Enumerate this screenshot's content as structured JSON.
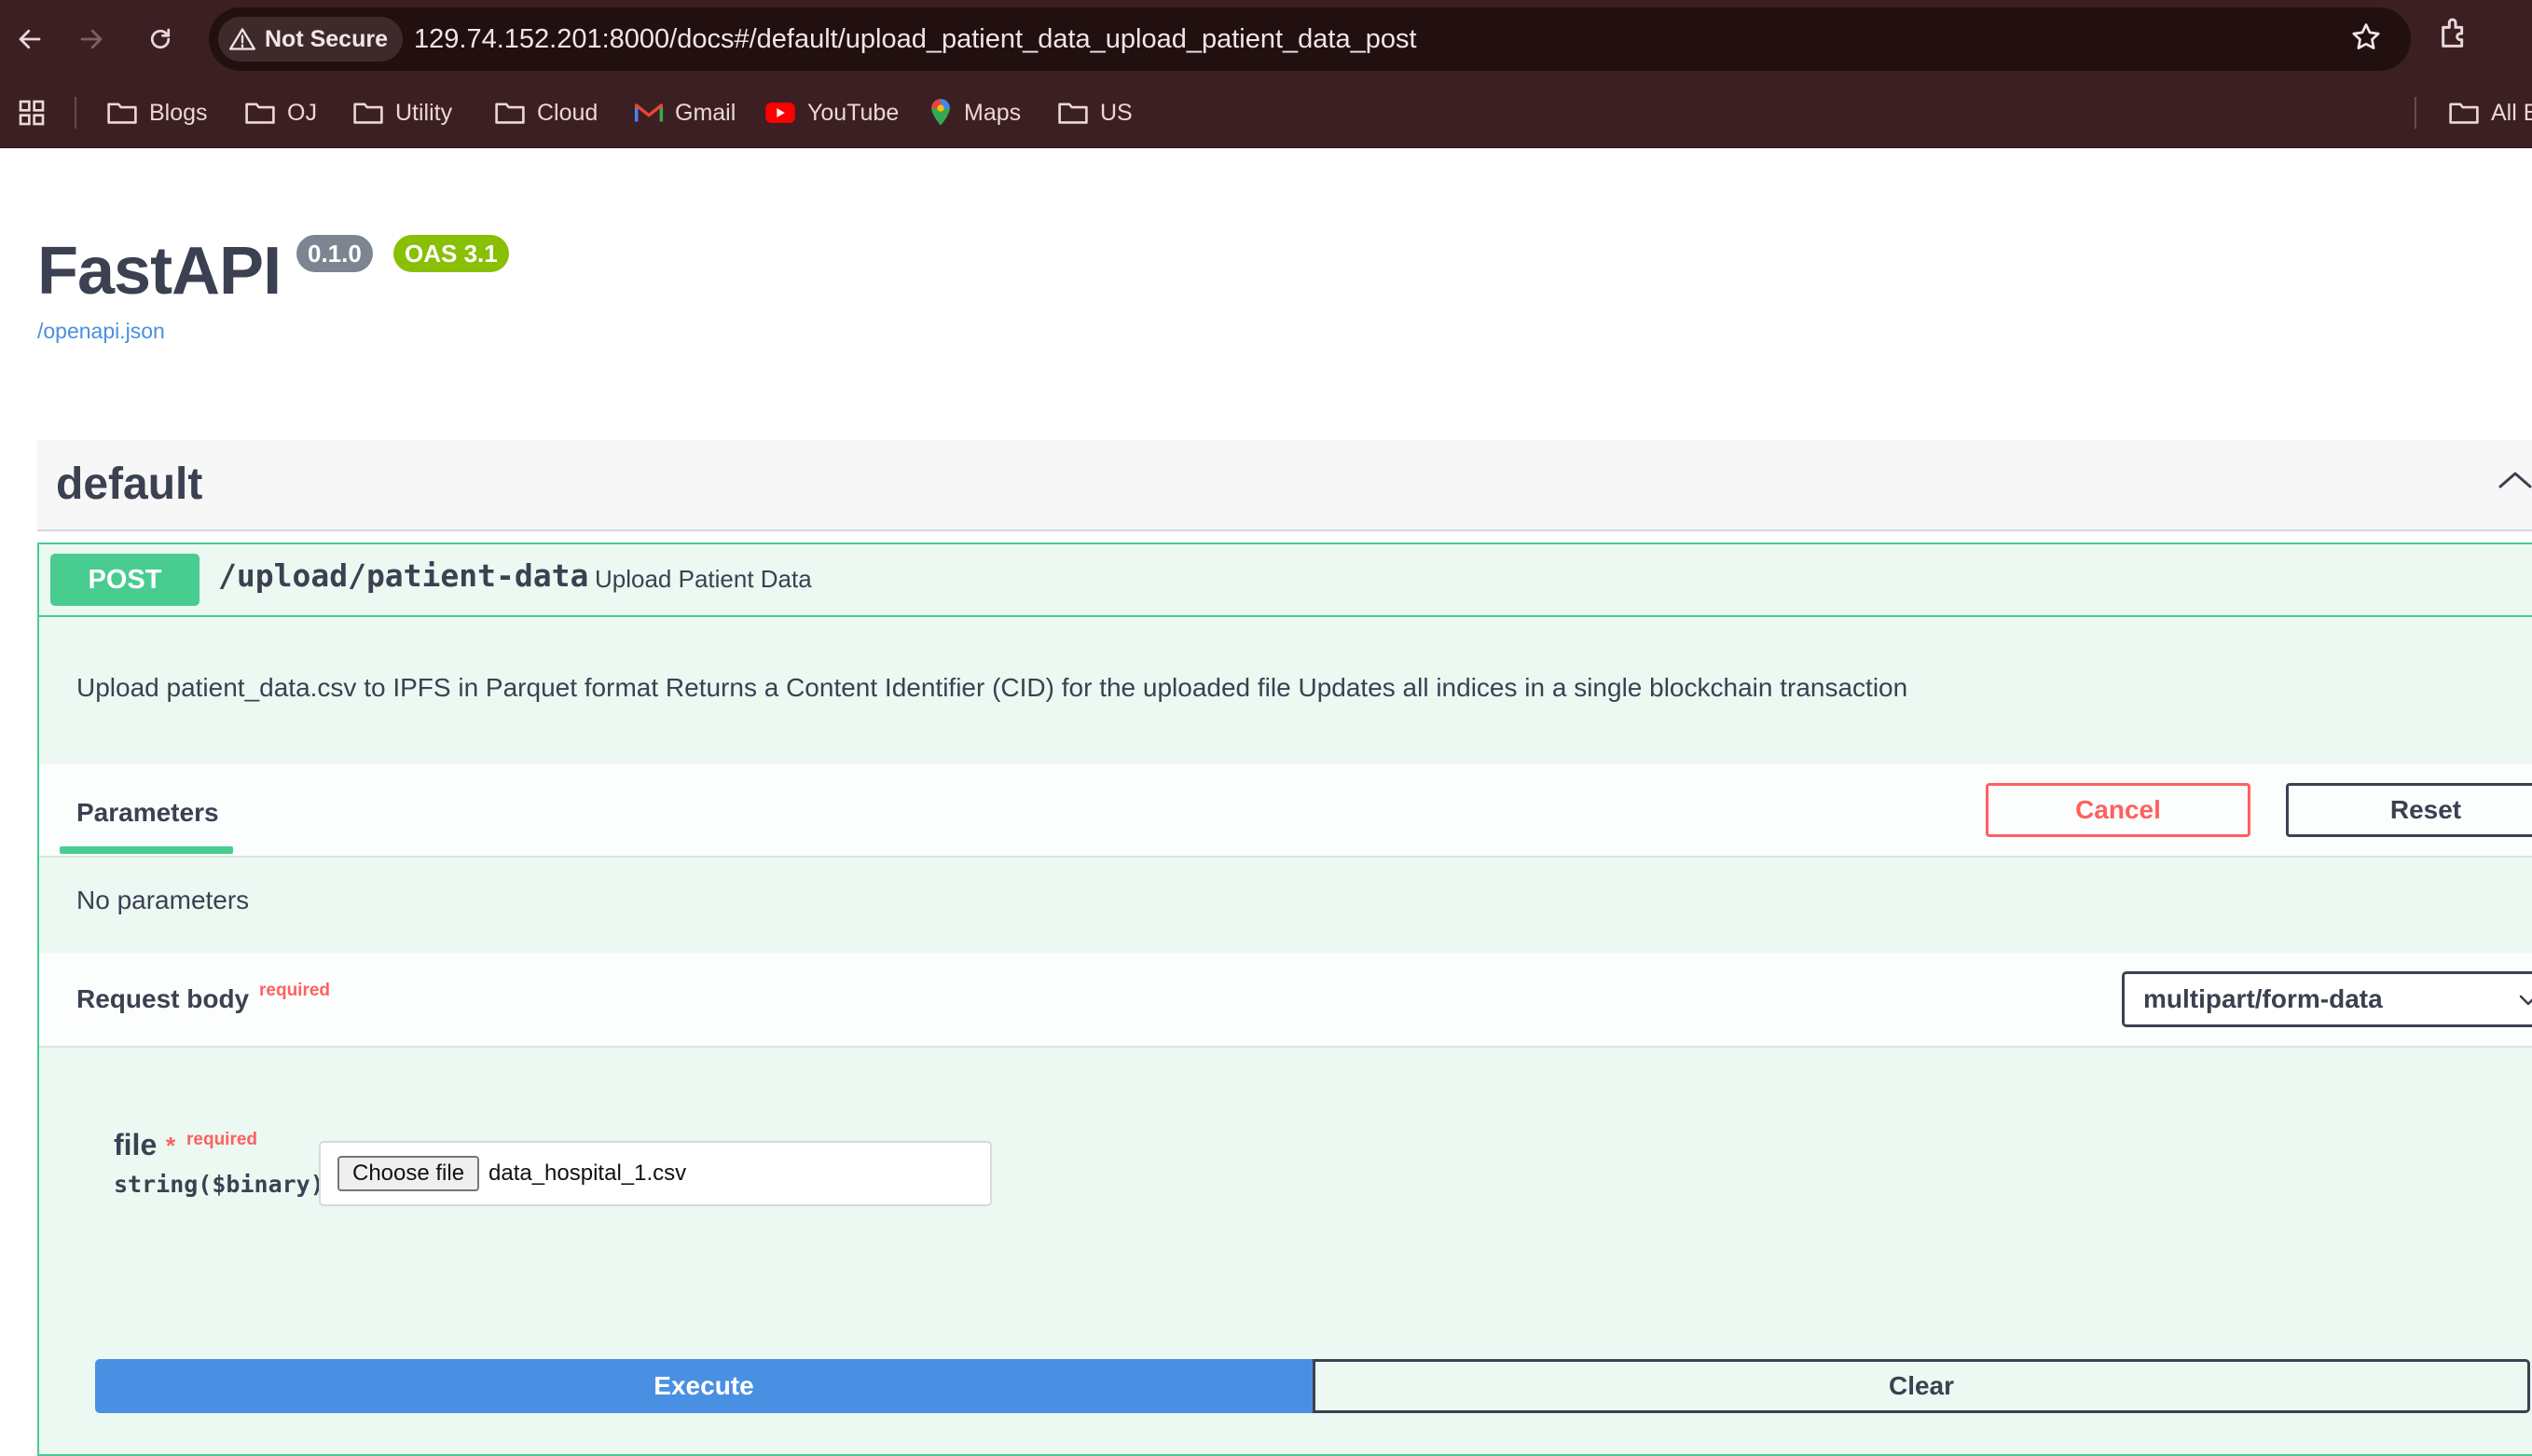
{
  "browser": {
    "security_label": "Not Secure",
    "url": "129.74.152.201:8000/docs#/default/upload_patient_data_upload_patient_data_post",
    "bookmarks": [
      "Blogs",
      "OJ",
      "Utility",
      "Cloud",
      "Gmail",
      "YouTube",
      "Maps",
      "US"
    ],
    "all_bookmarks_label": "All B"
  },
  "api": {
    "title": "FastAPI",
    "version": "0.1.0",
    "oas": "OAS 3.1",
    "openapi_link": "/openapi.json"
  },
  "tag": {
    "name": "default"
  },
  "operation": {
    "method": "POST",
    "path": "/upload/patient-data",
    "summary": "Upload Patient Data",
    "description": "Upload patient_data.csv to IPFS in Parquet format Returns a Content Identifier (CID) for the uploaded file Updates all indices in a single blockchain transaction",
    "parameters_label": "Parameters",
    "cancel_label": "Cancel",
    "reset_label": "Reset",
    "no_parameters": "No parameters",
    "request_body_label": "Request body",
    "required_label": "required",
    "content_type": "multipart/form-data",
    "file_field": {
      "name": "file",
      "star": "*",
      "required": "required",
      "type": "string($binary)",
      "choose_label": "Choose file",
      "selected_file": "data_hospital_1.csv"
    },
    "execute_label": "Execute",
    "clear_label": "Clear"
  },
  "colors": {
    "post_green": "#49cc90",
    "opblock_bg": "#ecf8f2",
    "execute_blue": "#4990e2",
    "cancel_red": "#ff6060",
    "chrome_bg": "#3b1f22"
  }
}
